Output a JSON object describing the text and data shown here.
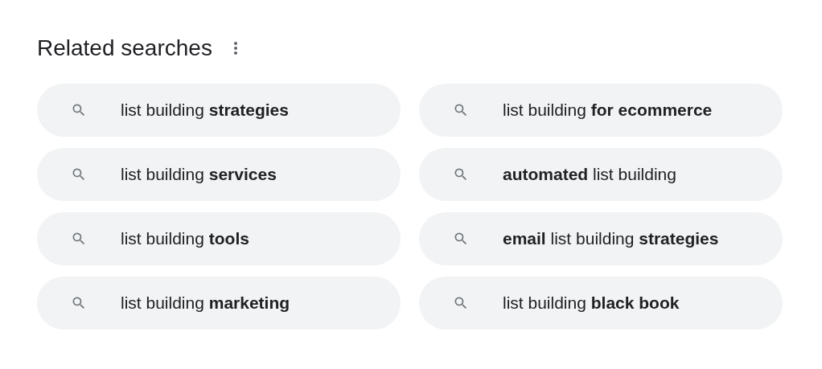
{
  "section": {
    "title": "Related searches"
  },
  "searches": [
    {
      "text": "list building **strategies**"
    },
    {
      "text": "list building **for ecommerce**"
    },
    {
      "text": "list building **services**"
    },
    {
      "text": "**automated** list building"
    },
    {
      "text": "list building **tools**"
    },
    {
      "text": "**email** list building **strategies**"
    },
    {
      "text": "list building **marketing**"
    },
    {
      "text": "list building **black book**"
    }
  ]
}
